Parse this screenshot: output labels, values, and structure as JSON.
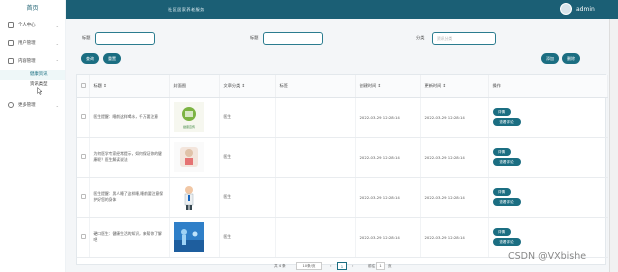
{
  "sidebar": {
    "top_link": "首页",
    "overlap_text": "首页",
    "items": [
      {
        "label": "个人中心"
      },
      {
        "label": "用户管理"
      },
      {
        "label": "内容管理"
      },
      {
        "label": "更多管理"
      }
    ],
    "sub_items": [
      {
        "label": "健康资讯"
      },
      {
        "label": "资讯类型"
      }
    ]
  },
  "topbar": {
    "title": "社区居家养老服务",
    "username": "admin"
  },
  "search": {
    "fields": [
      {
        "label": "标题",
        "placeholder": ""
      },
      {
        "label": "标题",
        "placeholder": ""
      },
      {
        "label": "分类",
        "placeholder": "资讯分类"
      }
    ],
    "query_label": "查询",
    "reset_label": "重置",
    "add_label": "添加",
    "delete_label": "删除"
  },
  "table": {
    "headers": [
      "标题",
      "封面图",
      "文章分类",
      "标签",
      "创建时间",
      "更新时间",
      "操作"
    ],
    "rows": [
      {
        "title": "医生提醒：睡前这样喝水，千万要注意",
        "category": "医生",
        "created": "2022-03-29 12:28:14",
        "updated": "2022-03-29 12:28:14",
        "cover": "poster",
        "cover_caption": "健康宣传"
      },
      {
        "title": "为何医学专家经常提示，如何保证你的健康呢？医生解读说法",
        "category": "医生",
        "created": "2022-03-29 12:28:14",
        "updated": "2022-03-29 12:28:14",
        "cover": "medical",
        "cover_caption": ""
      },
      {
        "title": "医生提醒：男人睡了这样睡,睡前要注意保护好您的身体",
        "category": "医生",
        "created": "2022-03-29 12:28:14",
        "updated": "2022-03-29 12:28:14",
        "cover": "doctor",
        "cover_caption": ""
      },
      {
        "title": "硬口医生：健康生活的知识，来帮你了解吧",
        "category": "医生",
        "created": "2022-03-29 12:28:14",
        "updated": "2022-03-29 12:28:14",
        "cover": "blue",
        "cover_caption": ""
      }
    ],
    "row_actions": {
      "detail": "详情",
      "comments": "查看评论"
    }
  },
  "pager": {
    "total": "共 4 条",
    "per_page": "10条/页",
    "prev": "‹",
    "current": "1",
    "next": "›",
    "goto_label": "前往",
    "goto_value": "1",
    "page_suffix": "页"
  },
  "watermark": "CSDN @VXbishe",
  "colors": {
    "accent": "#1b6e82",
    "topbar": "#1b5f75"
  }
}
